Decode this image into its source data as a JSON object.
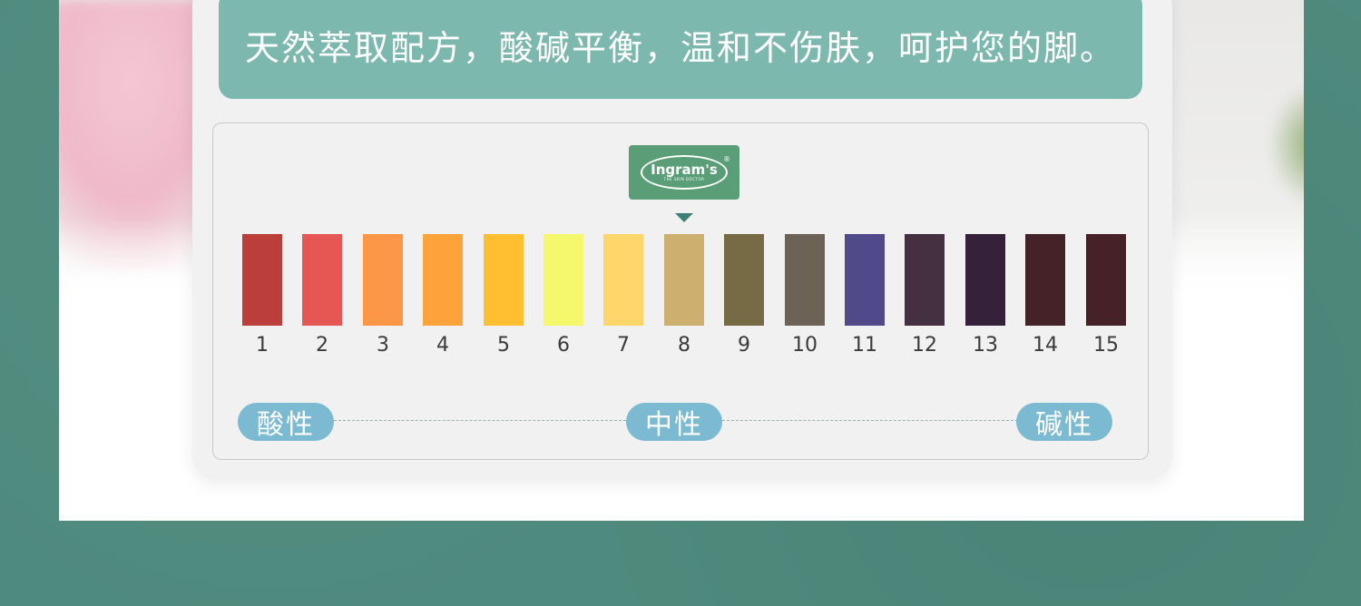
{
  "banner": {
    "text": "天然萃取配方，酸碱平衡，温和不伤肤，呵护您的脚。"
  },
  "brand": {
    "name": "Ingram's",
    "tagline": "THE SKIN DOCTOR",
    "registered": "®"
  },
  "scale": {
    "pointer_at": 8,
    "swatches": [
      {
        "label": "1",
        "color": "#bb3e3b"
      },
      {
        "label": "2",
        "color": "#e65753"
      },
      {
        "label": "3",
        "color": "#fd9748"
      },
      {
        "label": "4",
        "color": "#fea339"
      },
      {
        "label": "5",
        "color": "#ffbf31"
      },
      {
        "label": "6",
        "color": "#f5f86d"
      },
      {
        "label": "7",
        "color": "#ffd66b"
      },
      {
        "label": "8",
        "color": "#cdb06f"
      },
      {
        "label": "9",
        "color": "#776b46"
      },
      {
        "label": "10",
        "color": "#6d6256"
      },
      {
        "label": "11",
        "color": "#514a8a"
      },
      {
        "label": "12",
        "color": "#453042"
      },
      {
        "label": "13",
        "color": "#35223a"
      },
      {
        "label": "14",
        "color": "#442328"
      },
      {
        "label": "15",
        "color": "#472128"
      }
    ],
    "labels": {
      "acid": "酸性",
      "neutral": "中性",
      "alkaline": "碱性"
    }
  },
  "colors": {
    "background": "#4e8a7d",
    "banner": "#7db8af",
    "badge": "#5a9e78",
    "pill": "#7bbad0"
  }
}
